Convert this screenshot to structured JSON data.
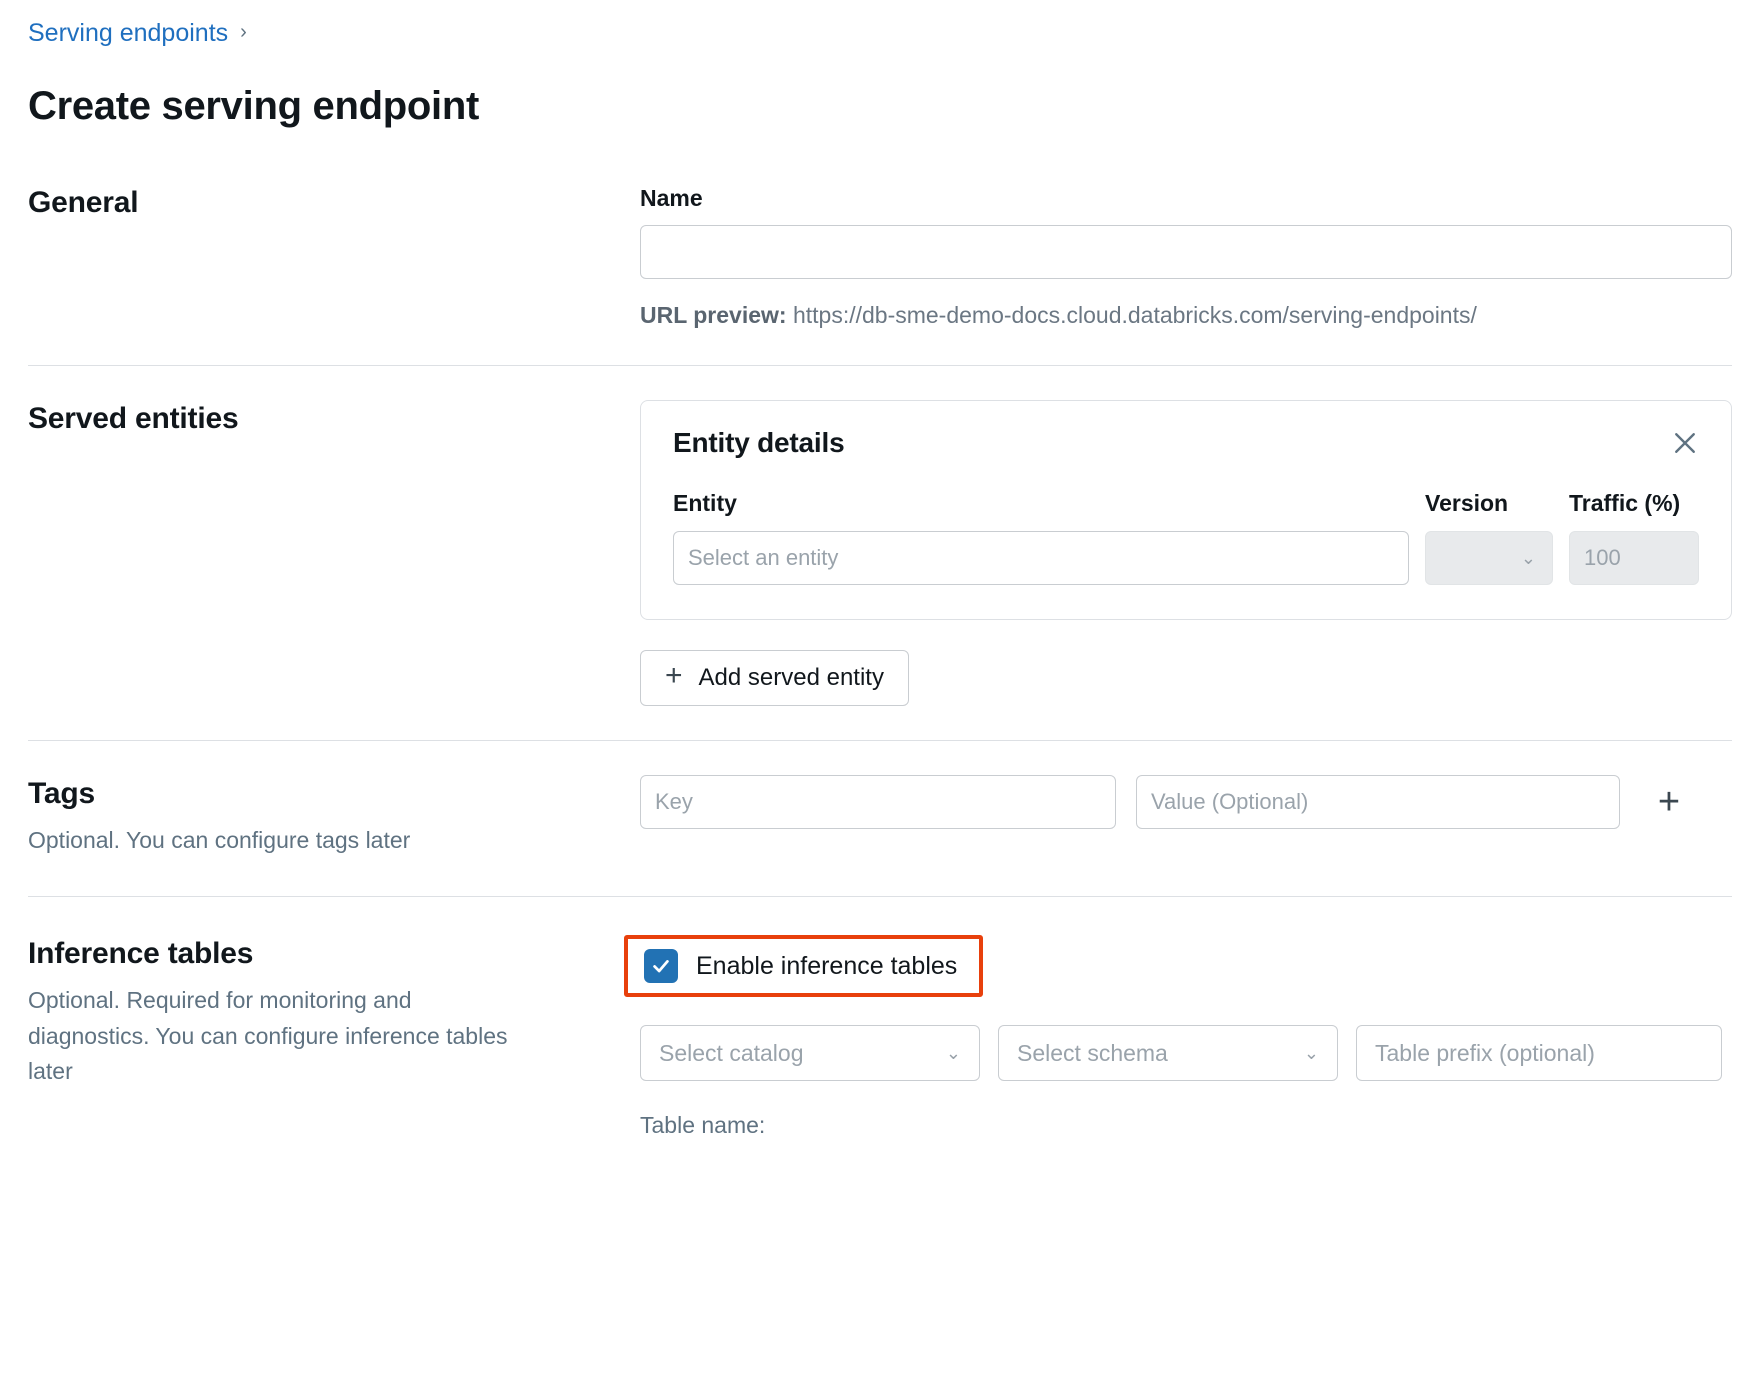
{
  "breadcrumb": {
    "parent": "Serving endpoints",
    "chevron_icon": "chevron-right-icon"
  },
  "page_title": "Create serving endpoint",
  "general": {
    "heading": "General",
    "name_label": "Name",
    "name_value": "",
    "name_placeholder": "",
    "url_preview_label": "URL preview:",
    "url_preview_value": "https://db-sme-demo-docs.cloud.databricks.com/serving-endpoints/"
  },
  "served_entities": {
    "heading": "Served entities",
    "card": {
      "title": "Entity details",
      "close_icon": "close-icon",
      "columns": {
        "entity": "Entity",
        "version": "Version",
        "traffic": "Traffic (%)"
      },
      "entity_placeholder": "Select an entity",
      "entity_value": "",
      "version_value": "",
      "version_chevron_icon": "chevron-down-icon",
      "traffic_value": "100"
    },
    "add_button_label": "Add served entity",
    "add_button_icon": "plus-icon"
  },
  "tags": {
    "heading": "Tags",
    "description": "Optional. You can configure tags later",
    "key_placeholder": "Key",
    "key_value": "",
    "value_placeholder": "Value (Optional)",
    "value_value": "",
    "add_icon": "plus-icon"
  },
  "inference_tables": {
    "heading": "Inference tables",
    "description": "Optional. Required for monitoring and diagnostics. You can configure inference tables later",
    "enable_label": "Enable inference tables",
    "enable_checked": true,
    "checkbox_icon": "check-icon",
    "catalog_placeholder": "Select catalog",
    "catalog_chevron_icon": "chevron-down-icon",
    "schema_placeholder": "Select schema",
    "schema_chevron_icon": "chevron-down-icon",
    "table_prefix_placeholder": "Table prefix (optional)",
    "table_prefix_value": "",
    "table_name_label": "Table name:"
  },
  "colors": {
    "link": "#1F6FBF",
    "highlight": "#E8400C",
    "checkbox": "#2272B4",
    "muted_text": "#5F7281",
    "border": "#C9CDD1"
  }
}
